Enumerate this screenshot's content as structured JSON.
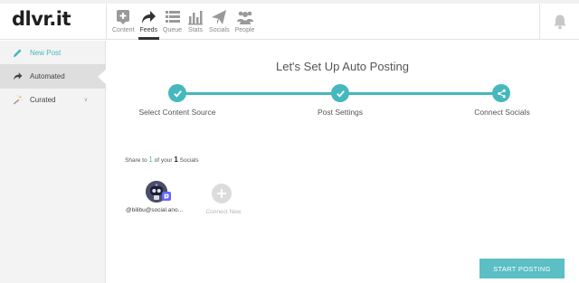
{
  "app": {
    "logo": "dlvr.it"
  },
  "nav": [
    {
      "label": "Content",
      "icon": "plus-square-icon",
      "active": false
    },
    {
      "label": "Feeds",
      "icon": "share-arrow-icon",
      "active": true
    },
    {
      "label": "Queue",
      "icon": "list-icon",
      "active": false
    },
    {
      "label": "Stats",
      "icon": "bar-chart-icon",
      "active": false
    },
    {
      "label": "Socials",
      "icon": "paper-plane-icon",
      "active": false
    },
    {
      "label": "People",
      "icon": "people-icon",
      "active": false
    }
  ],
  "sidebar": {
    "items": [
      {
        "label": "New Post",
        "icon": "pencil-icon"
      },
      {
        "label": "Automated",
        "icon": "share-arrow-icon"
      },
      {
        "label": "Curated",
        "icon": "magic-wand-icon",
        "chevron": "∨"
      }
    ]
  },
  "main": {
    "title": "Let's Set Up Auto Posting",
    "steps": [
      {
        "label": "Select Content Source",
        "icon": "check-icon"
      },
      {
        "label": "Post Settings",
        "icon": "check-icon"
      },
      {
        "label": "Connect Socials",
        "icon": "share-icon"
      }
    ],
    "share": {
      "prefix": "Share to",
      "count": "1",
      "middle": "of your",
      "total": "1",
      "suffix": "Socials"
    },
    "social": {
      "handle": "@bilibu@social.ano...",
      "network_icon": "mastodon-icon"
    },
    "connect_new": "Connect New",
    "start_button": "START POSTING"
  },
  "colors": {
    "accent": "#45b8be",
    "button": "#5bbfc5",
    "mastodon": "#6364ff"
  }
}
